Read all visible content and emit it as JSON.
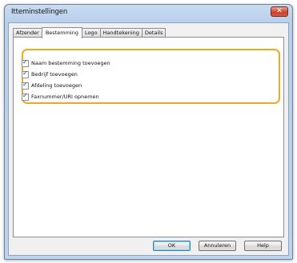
{
  "window": {
    "title": "Itteminstellingen",
    "close_label": "✕"
  },
  "tabs": [
    {
      "label": "Afzender",
      "active": false
    },
    {
      "label": "Bestemming",
      "active": true
    },
    {
      "label": "Logo",
      "active": false
    },
    {
      "label": "Handtekening",
      "active": false
    },
    {
      "label": "Details",
      "active": false
    }
  ],
  "options": [
    {
      "label": "Naam bestemming toevoegen",
      "checked": true
    },
    {
      "label": "Bedrijf toevoegen",
      "checked": true
    },
    {
      "label": "Afdeling toevoegen",
      "checked": true
    },
    {
      "label": "Faxnummer/URI opnemen",
      "checked": true
    }
  ],
  "check_glyph": "✓",
  "buttons": {
    "ok": "OK",
    "cancel": "Annuleren",
    "help": "Help"
  },
  "colors": {
    "highlight": "#f4a623",
    "close_button": "#c8412b"
  }
}
